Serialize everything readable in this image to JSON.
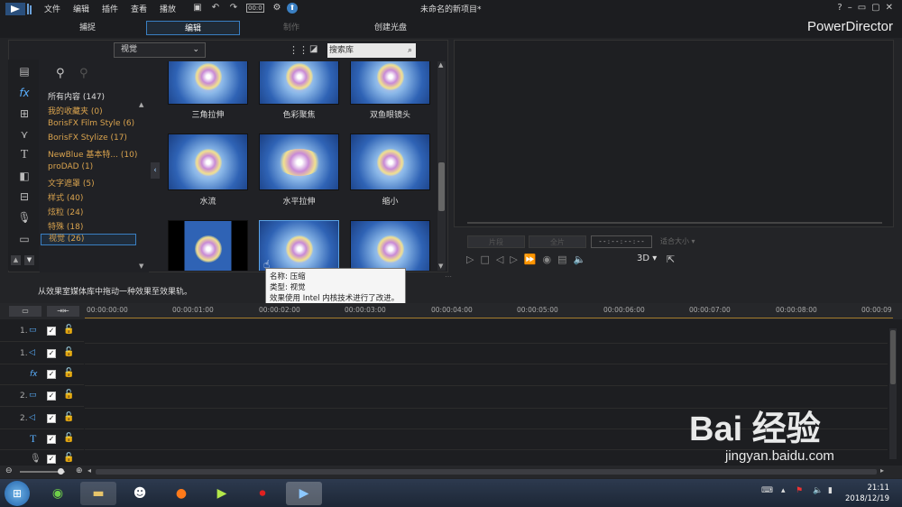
{
  "menu": [
    "文件",
    "编辑",
    "插件",
    "查看",
    "播放"
  ],
  "window_title": "未命名的新项目*",
  "timecode_badge": "00:0",
  "modes": [
    "捕捉",
    "编辑",
    "制作",
    "创建光盘"
  ],
  "brand": "PowerDirector",
  "library": {
    "filter_value": "视觉",
    "search_placeholder": "搜索库",
    "categories": [
      {
        "label": "所有内容 (147)"
      },
      {
        "label": "我的收藏夹  (0)"
      },
      {
        "label": "BorisFX Film Style  (6)"
      },
      {
        "label": "BorisFX Stylize  (17)"
      },
      {
        "label": "NewBlue 基本特...  (10)"
      },
      {
        "label": "proDAD  (1)"
      },
      {
        "label": "文字遮罩  (5)"
      },
      {
        "label": "样式  (40)"
      },
      {
        "label": "炫粒  (24)"
      },
      {
        "label": "特殊  (18)"
      },
      {
        "label": "视觉  (26)"
      }
    ],
    "effects": [
      {
        "label": "三角拉伸"
      },
      {
        "label": "色彩聚焦"
      },
      {
        "label": "双鱼眼镜头"
      },
      {
        "label": "水流"
      },
      {
        "label": "水平拉伸"
      },
      {
        "label": "缩小"
      },
      {
        "label": ""
      },
      {
        "label": ""
      },
      {
        "label": ""
      }
    ]
  },
  "tooltip": {
    "line1": "名称: 压缩",
    "line2": "类型: 视觉",
    "line3": "效果使用 Intel 内核技术进行了改进。"
  },
  "hint_text": "从效果室媒体库中拖动一种效果至效果轨。",
  "preview": {
    "btn_clip": "片段",
    "btn_movie": "全片",
    "timecode": "- - : - - : - - : - -",
    "size_label": "适合大小",
    "threed": "3D"
  },
  "timeline": {
    "ticks": [
      "00:00:00:00",
      "00:00:01:00",
      "00:00:02:00",
      "00:00:03:00",
      "00:00:04:00",
      "00:00:05:00",
      "00:00:06:00",
      "00:00:07:00",
      "00:00:08:00",
      "00:00:09"
    ],
    "tracks": [
      {
        "label": "1."
      },
      {
        "label": "1."
      },
      {
        "label": "fx"
      },
      {
        "label": "2."
      },
      {
        "label": "2."
      },
      {
        "label": "T"
      },
      {
        "label": ""
      }
    ]
  },
  "taskbar": {
    "time": "21:11",
    "date": "2018/12/19"
  },
  "watermark": {
    "main": "Bai 经验",
    "sub": "jingyan.baidu.com"
  },
  "colors": {
    "accent": "#3a7fc2",
    "category": "#d9a34e"
  }
}
